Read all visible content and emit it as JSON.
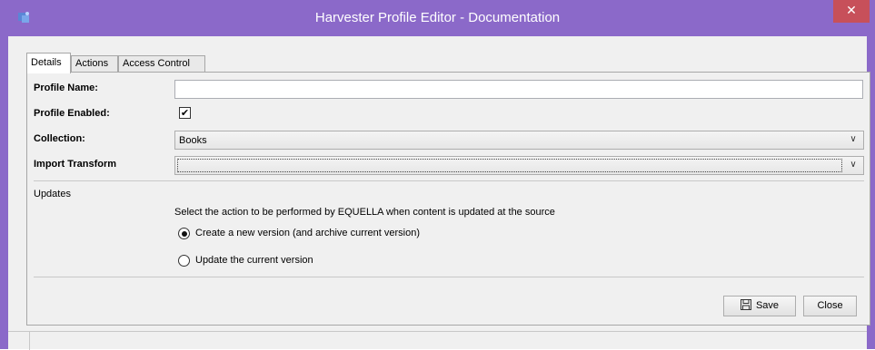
{
  "window": {
    "title": "Harvester Profile Editor - Documentation",
    "close_glyph": "✕",
    "app_icon": "equella-app-icon",
    "title_bar_color": "#8b69c9",
    "close_color": "#c7505a"
  },
  "tabs": [
    {
      "label": "Details",
      "active": true
    },
    {
      "label": "Actions",
      "active": false
    },
    {
      "label": "Access Control",
      "active": false
    }
  ],
  "form": {
    "profile_name": {
      "label": "Profile Name:",
      "value": ""
    },
    "profile_enabled": {
      "label": "Profile Enabled:",
      "checked": true,
      "check_glyph": "✔"
    },
    "collection": {
      "label": "Collection:",
      "value": "Books"
    },
    "import_transform": {
      "label": "Import Transform",
      "value": ""
    }
  },
  "updates": {
    "title": "Updates",
    "instruction": "Select the action to be performed by EQUELLA when content is updated at the source",
    "options": [
      {
        "label": "Create a new version (and archive current version)",
        "selected": true
      },
      {
        "label": "Update the current version",
        "selected": false
      }
    ]
  },
  "buttons": {
    "save_label": "Save",
    "close_label": "Close"
  },
  "icons": {
    "chevron": "∨"
  }
}
